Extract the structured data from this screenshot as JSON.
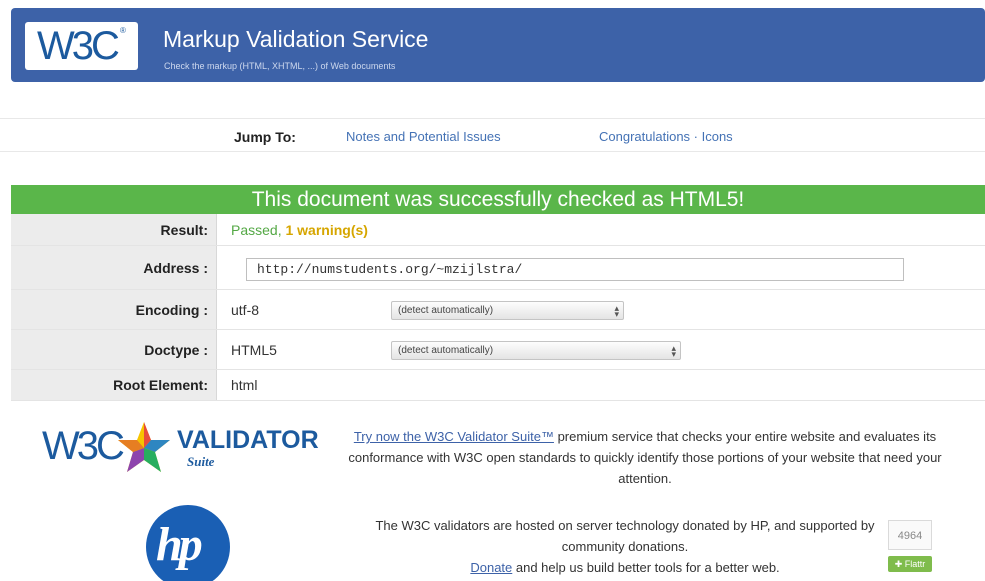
{
  "header": {
    "logo_text": "W3C",
    "title": "Markup Validation Service",
    "subtitle": "Check the markup (HTML, XHTML, ...) of Web documents"
  },
  "jump": {
    "label": "Jump To:",
    "links": [
      "Notes and Potential Issues",
      "Congratulations · Icons"
    ]
  },
  "banner": "This document was successfully checked as HTML5!",
  "results": {
    "result_label": "Result:",
    "result_passed": "Passed,",
    "result_warning": "1 warning(s)",
    "address_label": "Address :",
    "address_value": "http://numstudents.org/~mzijlstra/",
    "encoding_label": "Encoding :",
    "encoding_value": "utf-8",
    "encoding_select": "(detect automatically)",
    "doctype_label": "Doctype :",
    "doctype_value": "HTML5",
    "doctype_select": "(detect automatically)",
    "root_label": "Root Element:",
    "root_value": "html"
  },
  "promo": {
    "logo_w3c": "W3C",
    "logo_validator": "VALIDATOR",
    "logo_suite": "Suite",
    "link_text": "Try now the W3C Validator Suite™",
    "text_after": " premium service that checks your entire website and evaluates its conformance with W3C open standards to quickly identify those portions of your website that need your attention."
  },
  "hosted": {
    "logo_text": "hp",
    "line": "The W3C validators are hosted on server technology donated by HP, and supported by community donations.",
    "donate_link": "Donate",
    "donate_after": " and help us build better tools for a better web."
  },
  "flattr": {
    "count": "4964",
    "button": "Flattr"
  },
  "colors": {
    "header_bg": "#3d62a8",
    "banner_bg": "#5ab64a",
    "passed": "#54a845",
    "warning": "#d6a600",
    "link": "#4472b5"
  }
}
